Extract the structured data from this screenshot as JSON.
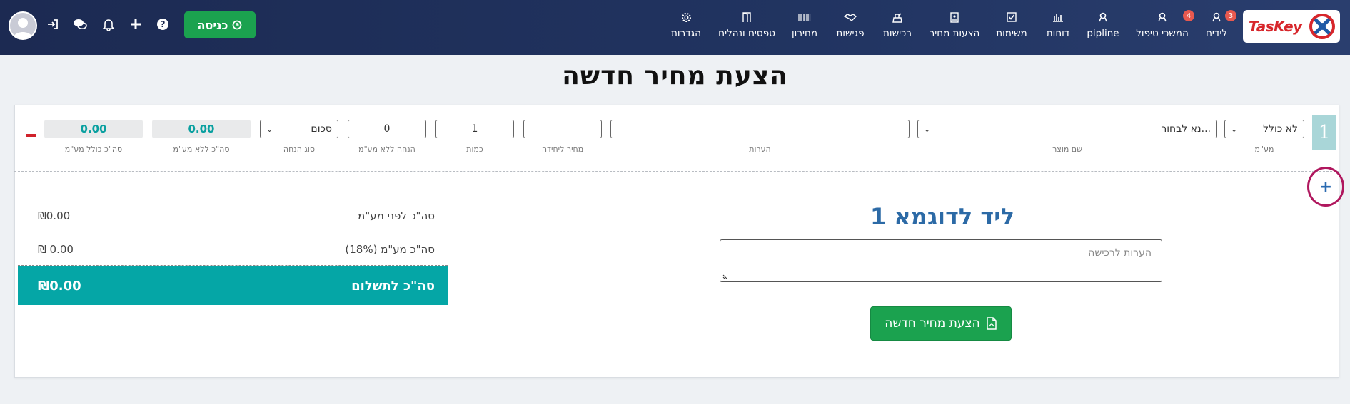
{
  "nav": {
    "items": [
      {
        "label": "לידים",
        "icon": "person-icon",
        "badge": "3"
      },
      {
        "label": "המשכי טיפול",
        "icon": "person-icon",
        "badge": "4"
      },
      {
        "label": "pipline",
        "icon": "person-icon"
      },
      {
        "label": "דוחות",
        "icon": "bar-chart-icon"
      },
      {
        "label": "משימות",
        "icon": "checkbox-icon"
      },
      {
        "label": "הצעות מחיר",
        "icon": "document-icon"
      },
      {
        "label": "רכישות",
        "icon": "cash-register-icon"
      },
      {
        "label": "פגישות",
        "icon": "handshake-icon"
      },
      {
        "label": "מחירון",
        "icon": "barcode-icon"
      },
      {
        "label": "טפסים ונהלים",
        "icon": "door-icon"
      },
      {
        "label": "הגדרות",
        "icon": "gear-icon"
      }
    ],
    "enter_label": "כניסה"
  },
  "logo": {
    "text": "TasKey"
  },
  "page": {
    "title": "הצעת מחיר חדשה"
  },
  "line": {
    "row_number": "1",
    "vat": {
      "value": "לא כולל",
      "label": "מע\"מ"
    },
    "product": {
      "value": "נא לבחור...",
      "label": "שם מוצר"
    },
    "notes": {
      "value": "",
      "label": "הערות"
    },
    "unit_price": {
      "value": "",
      "label": "מחיר ליחידה"
    },
    "quantity": {
      "value": "1",
      "label": "כמות"
    },
    "discount": {
      "value": "0",
      "label": "הנחה ללא מע\"מ"
    },
    "discount_type": {
      "value": "סכום",
      "label": "סוג הנחה"
    },
    "total_ex_vat": {
      "value": "0.00",
      "label": "סה\"כ ללא מע\"מ"
    },
    "total_inc_vat": {
      "value": "0.00",
      "label": "סה\"כ כולל מע\"מ"
    }
  },
  "lead": {
    "name": "ליד לדוגמא 1",
    "notes_placeholder": "הערות לרכישה"
  },
  "buttons": {
    "new_quote": "הצעת מחיר חדשה"
  },
  "summary": {
    "before_vat_label": "סה\"כ לפני מע\"מ",
    "before_vat_value": "0.00",
    "vat_label": "סה\"כ מע\"מ (18%)",
    "vat_value": "0.00",
    "total_label": "סה\"כ לתשלום",
    "total_value": "0.00",
    "currency": "₪"
  },
  "colors": {
    "accent": "#05a6a6",
    "primary_btn": "#1ba24f",
    "nav_bg": "#1c2a52",
    "lead": "#2c6aa6"
  }
}
